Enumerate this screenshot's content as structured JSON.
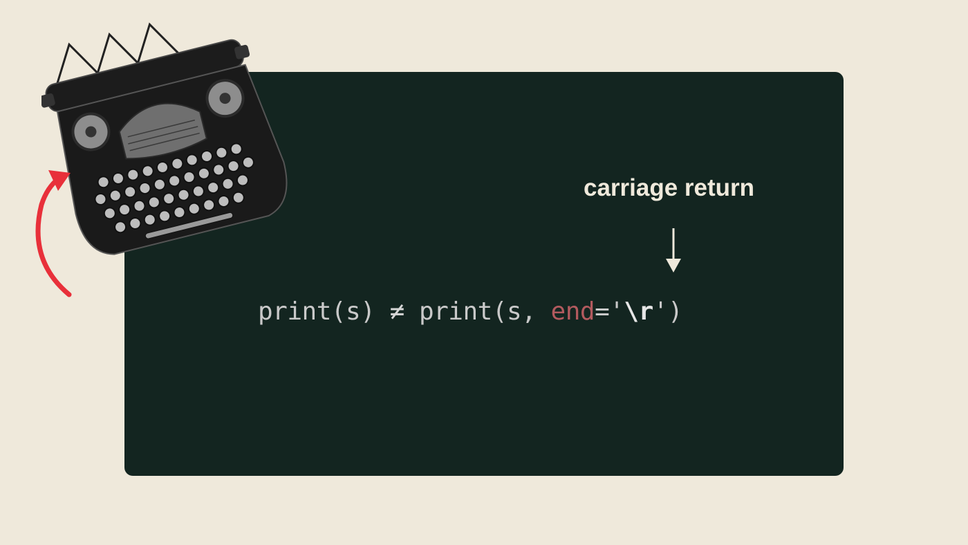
{
  "annotation": {
    "label": "carriage return"
  },
  "code": {
    "left_call": "print(s)",
    "operator": "≠",
    "right_call_start": "print(s, ",
    "keyword": "end",
    "equals_quote": "='",
    "escape": "\\r",
    "closing": "')"
  },
  "colors": {
    "background": "#efe9db",
    "panel": "#132520",
    "keyword": "#b25a5e",
    "arrow_red": "#e8303a"
  },
  "icons": {
    "typewriter": "typewriter-image",
    "curved_arrow": "curved-up-arrow-icon",
    "down_arrow": "down-arrow-icon"
  }
}
